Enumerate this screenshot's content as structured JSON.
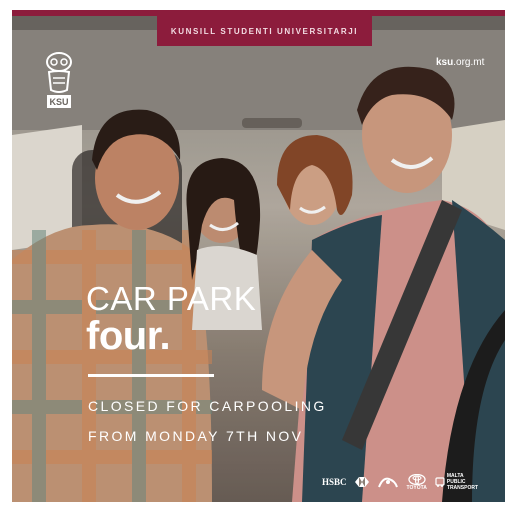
{
  "banner": {
    "text": "KUNSILL STUDENTI UNIVERSITARJI"
  },
  "logo": {
    "text": "KSU",
    "icon": "owl-icon"
  },
  "website": {
    "bold": "ksu",
    "rest": ".org.mt"
  },
  "headline": {
    "line1": "CAR PARK",
    "line2": "four."
  },
  "subtext": {
    "line1": "CLOSED FOR CARPOOLING",
    "line2": "FROM MONDAY 7TH NOV"
  },
  "sponsors": {
    "hsbc": "HSBC",
    "toyota": "TOYOTA",
    "transport_1": "MALTA",
    "transport_2": "PUBLIC",
    "transport_3": "TRANSPORT"
  },
  "colors": {
    "brand": "#8c1c3c",
    "text": "#ffffff"
  }
}
